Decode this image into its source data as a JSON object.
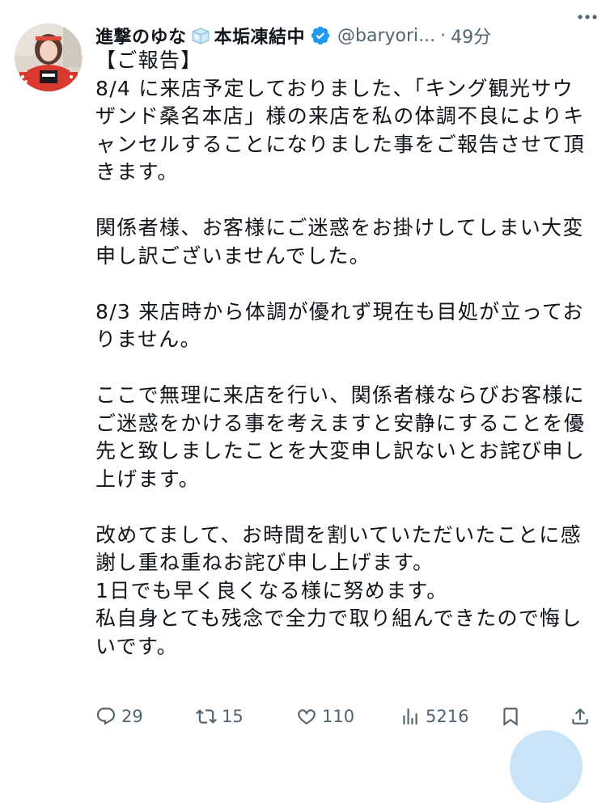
{
  "tweet": {
    "author": {
      "name_part1": "進撃のゆな",
      "name_part2": "本垢凍結中",
      "name_emoji": "ice-cube-emoji",
      "handle": "@baryori...",
      "separator": "·",
      "time": "49分"
    },
    "text": "【ご報告】\n8/4 に来店予定しておりました、「キング観光サウザンド桑名本店」様の来店を私の体調不良によりキャンセルすることになりました事をご報告させて頂きます。\n\n関係者様、お客様にご迷惑をお掛けしてしまい大変申し訳ございませんでした。\n\n8/3 来店時から体調が優れず現在も目処が立っておりません。\n\nここで無理に来店を行い、関係者様ならびお客様にご迷惑をかける事を考えますと安静にすることを優先と致しましたことを大変申し訳ないとお詫び申し上げます。\n\n改めてまして、お時間を割いていただいたことに感謝し重ね重ねお詫び申し上げます。\n1日でも早く良くなる様に努めます。\n私自身とても残念で全力で取り組んできたので悔しいです。",
    "metrics": {
      "replies": "29",
      "retweets": "15",
      "likes": "110",
      "views": "5216"
    }
  },
  "icons": [
    "more-icon",
    "verified-badge-icon",
    "reply-icon",
    "retweet-icon",
    "like-icon",
    "views-icon",
    "bookmark-icon",
    "share-icon"
  ],
  "colors": {
    "text_primary": "#0f1419",
    "text_secondary": "#536471",
    "verified_blue": "#1d9bf0"
  }
}
